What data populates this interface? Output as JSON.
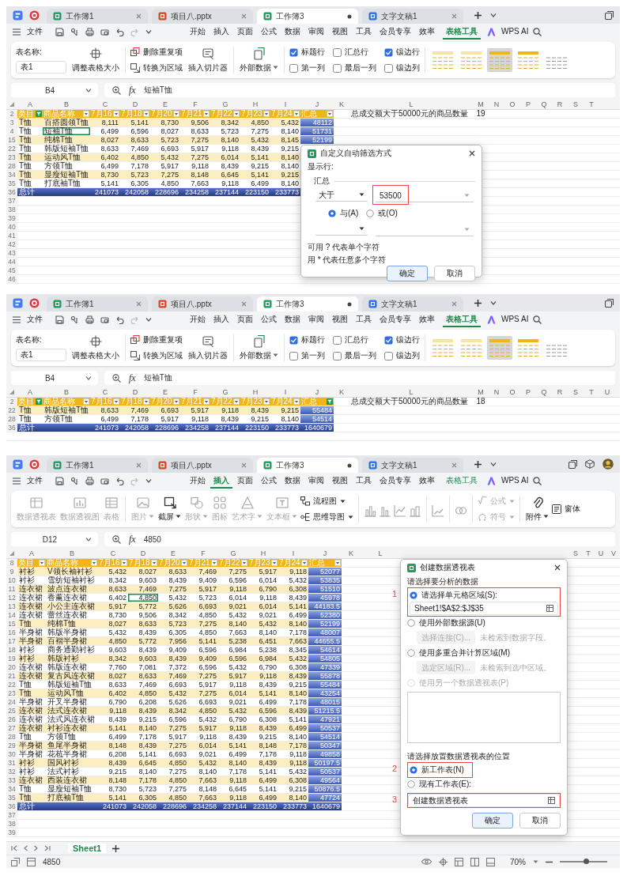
{
  "screenshots": [
    {
      "tabs": [
        {
          "label": "工作簿1",
          "kind": "sheet",
          "selected": false
        },
        {
          "label": "项目八.pptx",
          "kind": "slides",
          "selected": false
        },
        {
          "label": "工作簿3",
          "kind": "sheet",
          "selected": true
        },
        {
          "label": "文字文稿1",
          "kind": "doc",
          "selected": false
        }
      ],
      "menu": {
        "file": "文件",
        "items": [
          {
            "label": "开始",
            "selected": false
          },
          {
            "label": "插入",
            "selected": false
          },
          {
            "label": "页面",
            "selected": false
          },
          {
            "label": "公式",
            "selected": false
          },
          {
            "label": "数据",
            "selected": false
          },
          {
            "label": "审阅",
            "selected": false
          },
          {
            "label": "视图",
            "selected": false
          },
          {
            "label": "工具",
            "selected": false
          },
          {
            "label": "会员专享",
            "selected": false
          },
          {
            "label": "效率",
            "selected": false
          }
        ],
        "context": {
          "label": "表格工具",
          "selected": true
        },
        "ai": "WPS AI"
      },
      "ribbon": {
        "kind": "table_tools",
        "name_label": "表名称:",
        "table_name": "表1",
        "resize": "调整表格大小",
        "remove_duplicates": "删除重复项",
        "convert": "转换为区域",
        "slicer": "插入切片器",
        "external": "外部数据",
        "options": [
          {
            "label": "标题行",
            "checked": true
          },
          {
            "label": "汇总行",
            "checked": false
          },
          {
            "label": "镶边行",
            "checked": true
          },
          {
            "label": "第一列",
            "checked": false
          },
          {
            "label": "最后一列",
            "checked": false
          },
          {
            "label": "镶边列",
            "checked": false
          }
        ],
        "styles": [
          {
            "selected": false
          },
          {
            "selected": false
          },
          {
            "selected": true
          },
          {
            "selected": false
          },
          {
            "selected": false
          }
        ]
      },
      "formula": {
        "cell": "B4",
        "fx": "fx",
        "value": "短袖T恤"
      },
      "columns": [
        "A",
        "B",
        "C",
        "D",
        "E",
        "F",
        "G",
        "H",
        "I",
        "J",
        "K",
        "L",
        "M",
        "N",
        "O",
        "P",
        "Q",
        "R",
        "S",
        "T"
      ],
      "header": {
        "row": "2",
        "cells": [
          {
            "label": "类目",
            "filtered": true
          },
          {
            "label": "商品名称",
            "filtered": false
          },
          {
            "label": "7月16",
            "filtered": false
          },
          {
            "label": "7月18",
            "filtered": false
          },
          {
            "label": "7月20",
            "filtered": false
          },
          {
            "label": "7月21",
            "filtered": false
          },
          {
            "label": "7月22",
            "filtered": false
          },
          {
            "label": "7月23",
            "filtered": false
          },
          {
            "label": "7月24",
            "filtered": false
          },
          {
            "label": "汇总",
            "filtered": false
          }
        ],
        "note": {
          "label": "总成交额大于50000元的商品数量",
          "value": "19"
        }
      },
      "rows": [
        {
          "row": "3",
          "kind": "data",
          "cells": [
            "T恤",
            "百搭圆领T恤",
            "8,111",
            "5,141",
            "8,730",
            "9,506",
            "8,342",
            "4,850",
            "5,432",
            "48112"
          ]
        },
        {
          "row": "4",
          "kind": "data",
          "cells": [
            "T恤",
            {
              "text": "短袖T恤",
              "selected": true
            },
            "6,499",
            "6,596",
            "8,027",
            "8,633",
            "5,723",
            "7,275",
            "8,140",
            "51731"
          ]
        },
        {
          "row": "15",
          "kind": "data",
          "cells": [
            "T恤",
            "纯棉T恤",
            "8,027",
            "8,633",
            "5,723",
            "7,275",
            "8,140",
            "5,432",
            "8,145",
            "52199"
          ]
        },
        {
          "row": "22",
          "kind": "data",
          "cells": [
            "T恤",
            "韩版短袖T恤",
            "8,633",
            "7,469",
            "6,693",
            "5,917",
            "9,118",
            "8,439",
            "9,215",
            null
          ]
        },
        {
          "row": "23",
          "kind": "data",
          "cells": [
            "T恤",
            "运动风T恤",
            "6,402",
            "4,850",
            "5,432",
            "7,275",
            "6,014",
            "5,141",
            "8,140",
            null
          ]
        },
        {
          "row": "28",
          "kind": "data",
          "cells": [
            "T恤",
            "方领T恤",
            "6,499",
            "7,178",
            "5,917",
            "9,118",
            "8,439",
            "9,215",
            "8,140",
            null
          ]
        },
        {
          "row": "34",
          "kind": "data",
          "cells": [
            "T恤",
            "显瘦短袖T恤",
            "8,730",
            "5,723",
            "7,275",
            "8,148",
            "6,645",
            "5,141",
            "9,215",
            null
          ]
        },
        {
          "row": "35",
          "kind": "data",
          "cells": [
            "T恤",
            "打底袖T恤",
            "5,141",
            "6,305",
            "4,850",
            "7,663",
            "9,118",
            "6,499",
            "8,140",
            null
          ]
        },
        {
          "row": "36",
          "kind": "total",
          "cells": [
            "总计",
            null,
            "241073",
            "242058",
            "228696",
            "234258",
            "237144",
            "223150",
            "233773",
            null
          ]
        }
      ],
      "empty_rows": [
        "37",
        "38",
        "39",
        "40",
        "41",
        "42",
        "43",
        "44",
        "45",
        "46"
      ],
      "dialog": {
        "kind": "autofilter",
        "title": "自定义自动筛选方式",
        "show_rows": "显示行:",
        "field": "汇总",
        "conditions": [
          {
            "operator": "大于",
            "value": "53500",
            "marked": true
          },
          {
            "marked": false
          }
        ],
        "logic": [
          {
            "label": "与(A)",
            "selected": true
          },
          {
            "label": "或(O)",
            "selected": false
          }
        ],
        "hints": [
          "可用 ? 代表单个字符",
          "用 * 代表任意多个字符"
        ],
        "buttons": [
          {
            "label": "确定",
            "kind": "primary"
          },
          {
            "label": "取消",
            "kind": "normal"
          }
        ]
      }
    },
    {
      "tabs": [
        {
          "label": "工作簿1",
          "kind": "sheet",
          "selected": false
        },
        {
          "label": "项目八.pptx",
          "kind": "slides",
          "selected": false
        },
        {
          "label": "工作簿3",
          "kind": "sheet",
          "selected": true
        },
        {
          "label": "文字文稿1",
          "kind": "doc",
          "selected": false
        }
      ],
      "menu": {
        "file": "文件",
        "items": [
          {
            "label": "开始",
            "selected": false
          },
          {
            "label": "插入",
            "selected": false
          },
          {
            "label": "页面",
            "selected": false
          },
          {
            "label": "公式",
            "selected": false
          },
          {
            "label": "数据",
            "selected": false
          },
          {
            "label": "审阅",
            "selected": false
          },
          {
            "label": "视图",
            "selected": false
          },
          {
            "label": "工具",
            "selected": false
          },
          {
            "label": "会员专享",
            "selected": false
          },
          {
            "label": "效率",
            "selected": false
          }
        ],
        "context": {
          "label": "表格工具",
          "selected": true
        },
        "ai": "WPS AI"
      },
      "ribbon": {
        "kind": "table_tools",
        "name_label": "表名称:",
        "table_name": "表1",
        "resize": "调整表格大小",
        "remove_duplicates": "删除重复项",
        "convert": "转换为区域",
        "slicer": "插入切片器",
        "external": "外部数据",
        "options": [
          {
            "label": "标题行",
            "checked": true
          },
          {
            "label": "汇总行",
            "checked": false
          },
          {
            "label": "镶边行",
            "checked": true
          },
          {
            "label": "第一列",
            "checked": false
          },
          {
            "label": "最后一列",
            "checked": false
          },
          {
            "label": "镶边列",
            "checked": false
          }
        ],
        "styles": [
          {
            "selected": false
          },
          {
            "selected": false
          },
          {
            "selected": true
          },
          {
            "selected": false
          },
          {
            "selected": false
          }
        ]
      },
      "formula": {
        "cell": "B4",
        "fx": "fx",
        "value": "短袖T恤"
      },
      "columns": [
        "A",
        "B",
        "C",
        "D",
        "E",
        "F",
        "G",
        "H",
        "I",
        "J",
        "K",
        "L",
        "M",
        "N",
        "O",
        "P",
        "Q",
        "R",
        "S",
        "T",
        "U"
      ],
      "header": {
        "row": "2",
        "cells": [
          {
            "label": "类目",
            "filtered": true
          },
          {
            "label": "商品名称",
            "filtered": false
          },
          {
            "label": "7月16",
            "filtered": false
          },
          {
            "label": "7月18",
            "filtered": false
          },
          {
            "label": "7月20",
            "filtered": false
          },
          {
            "label": "7月21",
            "filtered": false
          },
          {
            "label": "7月22",
            "filtered": false
          },
          {
            "label": "7月23",
            "filtered": false
          },
          {
            "label": "7月24",
            "filtered": false
          },
          {
            "label": "汇总",
            "filtered": true
          }
        ],
        "note": {
          "label": "总成交额大于50000元的商品数量",
          "value": "18"
        }
      },
      "rows": [
        {
          "row": "22",
          "kind": "data",
          "cells": [
            "T恤",
            "韩版短袖T恤",
            "8,633",
            "7,469",
            "6,693",
            "5,917",
            "9,118",
            "8,439",
            "9,215",
            "55484"
          ]
        },
        {
          "row": "28",
          "kind": "data",
          "cells": [
            "T恤",
            "方领T恤",
            "6,499",
            "7,178",
            "5,917",
            "9,118",
            "8,439",
            "9,215",
            "8,140",
            "54514"
          ]
        },
        {
          "row": "36",
          "kind": "total",
          "cells": [
            "总计",
            null,
            "241073",
            "242058",
            "228696",
            "234258",
            "237144",
            "223150",
            "233773",
            "1640679"
          ]
        }
      ]
    },
    {
      "tabs": [
        {
          "label": "工作簿1",
          "kind": "sheet",
          "selected": false
        },
        {
          "label": "项目八.pptx",
          "kind": "slides",
          "selected": false
        },
        {
          "label": "工作簿3",
          "kind": "sheet",
          "selected": true
        },
        {
          "label": "文字文稿1",
          "kind": "doc",
          "selected": false
        }
      ],
      "account": true,
      "menu": {
        "file": "文件",
        "items": [
          {
            "label": "开始",
            "selected": false
          },
          {
            "label": "插入",
            "selected": true
          },
          {
            "label": "页面",
            "selected": false
          },
          {
            "label": "公式",
            "selected": false
          },
          {
            "label": "数据",
            "selected": false
          },
          {
            "label": "审阅",
            "selected": false
          },
          {
            "label": "视图",
            "selected": false
          },
          {
            "label": "工具",
            "selected": false
          },
          {
            "label": "会员专享",
            "selected": false
          },
          {
            "label": "效率",
            "selected": false
          }
        ],
        "context": {
          "label": "表格工具",
          "selected": false
        },
        "ai": "WPS AI"
      },
      "ribbon": {
        "kind": "insert",
        "groups": [
          {
            "items": [
              {
                "kind": "big",
                "label": "数据透视表",
                "disabled": true
              },
              {
                "kind": "big",
                "label": "数据透视图",
                "disabled": true
              },
              {
                "kind": "big",
                "label": "表格",
                "disabled": true
              }
            ]
          },
          {
            "items": [
              {
                "kind": "big",
                "label": "图片",
                "caret": true,
                "disabled": true
              },
              {
                "kind": "big",
                "label": "截屏",
                "caret": true,
                "disabled": false
              },
              {
                "kind": "big",
                "label": "形状",
                "caret": true,
                "disabled": true
              },
              {
                "kind": "big",
                "label": "图标",
                "disabled": true
              },
              {
                "kind": "big",
                "label": "艺术字",
                "caret": true,
                "disabled": true
              },
              {
                "kind": "big",
                "label": "文本框",
                "caret": true,
                "disabled": true
              },
              {
                "kind": "small",
                "label": "流程图",
                "caret": true,
                "disabled": false
              },
              {
                "kind": "small",
                "label": "思维导图",
                "caret": true,
                "disabled": false
              }
            ]
          },
          {
            "items": [
              {
                "kind": "chart",
                "disabled": true
              },
              {
                "kind": "chart",
                "disabled": true
              },
              {
                "kind": "chart",
                "disabled": true
              },
              {
                "kind": "chart",
                "disabled": true
              }
            ]
          },
          {
            "items": [
              {
                "kind": "chart",
                "disabled": true
              }
            ]
          },
          {
            "items": [
              {
                "kind": "chart",
                "disabled": true
              }
            ]
          },
          {
            "items": [
              {
                "kind": "small",
                "label": "公式",
                "caret": true,
                "disabled": true
              },
              {
                "kind": "small",
                "label": "符号",
                "caret": true,
                "disabled": true
              }
            ]
          },
          {
            "items": [
              {
                "kind": "big",
                "label": "附件",
                "caret": true,
                "disabled": false
              },
              {
                "kind": "small",
                "label": "窗体",
                "disabled": false
              }
            ]
          }
        ]
      },
      "formula": {
        "cell": "D12",
        "fx": "fx",
        "value": "4850"
      },
      "columns": [
        "A",
        "B",
        "C",
        "D",
        "E",
        "F",
        "G",
        "H",
        "I",
        "J",
        "K",
        "L"
      ],
      "columns_right": [
        "S",
        "T",
        "U",
        "V"
      ],
      "header": {
        "row": "8",
        "cells": [
          {
            "label": "类目",
            "filtered": false
          },
          {
            "label": "商品名称",
            "filtered": false
          },
          {
            "label": "7月16",
            "filtered": false
          },
          {
            "label": "7月18",
            "filtered": false
          },
          {
            "label": "7月20",
            "filtered": false
          },
          {
            "label": "7月21",
            "filtered": false
          },
          {
            "label": "7月22",
            "filtered": false
          },
          {
            "label": "7月23",
            "filtered": false
          },
          {
            "label": "7月24",
            "filtered": false
          },
          {
            "label": "汇总",
            "filtered": false
          }
        ]
      },
      "rows": [
        {
          "row": "9",
          "kind": "data",
          "cells": [
            "衬衫",
            "V领长袖衬衫",
            "5,432",
            "8,027",
            "8,633",
            "7,469",
            "7,275",
            "5,917",
            "9,118",
            "52077"
          ]
        },
        {
          "row": "10",
          "kind": "data",
          "cells": [
            "衬衫",
            "雪纺短袖衬衫",
            "8,342",
            "9,603",
            "8,439",
            "9,409",
            "6,596",
            "6,014",
            "5,432",
            "53835"
          ]
        },
        {
          "row": "11",
          "kind": "data",
          "cells": [
            "连衣裙",
            "波点连衣裙",
            "8,633",
            "7,469",
            "7,275",
            "5,917",
            "9,118",
            "6,790",
            "6,308",
            "51510"
          ]
        },
        {
          "row": "12",
          "kind": "data",
          "cells": [
            "连衣裙",
            "香薰连衣裙",
            "6,402",
            {
              "text": "4,850",
              "selected": true
            },
            "5,432",
            "5,723",
            "6,014",
            "9,118",
            "8,439",
            "45978"
          ]
        },
        {
          "row": "13",
          "kind": "data",
          "cells": [
            "连衣裙",
            "小公主连衣裙",
            "5,917",
            "5,772",
            "5,626",
            "6,693",
            "9,021",
            "6,014",
            "5,141",
            "44183.5"
          ]
        },
        {
          "row": "14",
          "kind": "data",
          "cells": [
            "连衣裙",
            "蕾丝连衣裙",
            "8,730",
            "9,506",
            "8,342",
            "4,850",
            "5,432",
            "9,021",
            "6,499",
            "52380"
          ]
        },
        {
          "row": "15",
          "kind": "data",
          "cells": [
            "T恤",
            "纯棉T恤",
            "8,027",
            "8,633",
            "5,723",
            "7,275",
            "8,140",
            "5,432",
            "8,140",
            "52199"
          ]
        },
        {
          "row": "16",
          "kind": "data",
          "cells": [
            "半身裙",
            "韩版半身裙",
            "5,432",
            "8,439",
            "6,305",
            "4,850",
            "7,663",
            "8,140",
            "7,178",
            "48007"
          ]
        },
        {
          "row": "17",
          "kind": "data",
          "cells": [
            "半身裙",
            "百褶半身裙",
            "4,850",
            "5,772",
            "7,956",
            "5,141",
            "5,238",
            "6,451",
            "7,663",
            "44655.5"
          ]
        },
        {
          "row": "18",
          "kind": "data",
          "cells": [
            "衬衫",
            "商务通勤衬衫",
            "9,603",
            "8,439",
            "9,409",
            "6,596",
            "6,984",
            "5,238",
            "8,345",
            "54614"
          ]
        },
        {
          "row": "19",
          "kind": "data",
          "cells": [
            "衬衫",
            "韩版衬衫",
            "8,342",
            "9,603",
            "8,439",
            "9,409",
            "6,596",
            "6,984",
            "5,432",
            "54805"
          ]
        },
        {
          "row": "20",
          "kind": "data",
          "cells": [
            "连衣裙",
            "韩版连衣裙",
            "7,760",
            "7,081",
            "7,372",
            "6,596",
            "5,432",
            "6,790",
            "6,308",
            "47339"
          ]
        },
        {
          "row": "21",
          "kind": "data",
          "cells": [
            "连衣裙",
            "复古风连衣裙",
            "8,027",
            "8,633",
            "7,469",
            "7,275",
            "5,917",
            "9,118",
            "8,439",
            "55878"
          ]
        },
        {
          "row": "22",
          "kind": "data",
          "cells": [
            "T恤",
            "韩版短袖T恤",
            "8,633",
            "7,469",
            "6,693",
            "5,917",
            "9,118",
            "8,439",
            "9,215",
            "55484"
          ]
        },
        {
          "row": "23",
          "kind": "data",
          "cells": [
            "T恤",
            "运动风T恤",
            "6,402",
            "4,850",
            "5,432",
            "7,275",
            "6,014",
            "5,141",
            "8,140",
            "43254"
          ]
        },
        {
          "row": "24",
          "kind": "data",
          "cells": [
            "半身裙",
            "开叉半身裙",
            "6,790",
            "6,208",
            "5,626",
            "6,693",
            "9,021",
            "6,499",
            "7,178",
            "48015"
          ]
        },
        {
          "row": "25",
          "kind": "data",
          "cells": [
            "连衣裙",
            "法式连衣裙",
            "9,118",
            "8,439",
            "8,342",
            "4,850",
            "5,432",
            "6,596",
            "8,439",
            "51215.5"
          ]
        },
        {
          "row": "26",
          "kind": "data",
          "cells": [
            "连衣裙",
            "法式风连衣裙",
            "8,439",
            "9,215",
            "6,596",
            "5,432",
            "6,790",
            "6,308",
            "5,141",
            "47921"
          ]
        },
        {
          "row": "27",
          "kind": "data",
          "cells": [
            "连衣裙",
            "衬衫连衣裙",
            "5,141",
            "8,140",
            "7,275",
            "5,917",
            "9,118",
            "8,439",
            "6,499",
            "50537"
          ]
        },
        {
          "row": "28",
          "kind": "data",
          "cells": [
            "T恤",
            "方领T恤",
            "6,499",
            "7,178",
            "5,917",
            "9,118",
            "8,439",
            "9,215",
            "8,140",
            "54514"
          ]
        },
        {
          "row": "29",
          "kind": "data",
          "cells": [
            "半身裙",
            "鱼尾半身裙",
            "8,148",
            "8,439",
            "7,275",
            "6,014",
            "5,141",
            "8,148",
            "7,178",
            "50347"
          ]
        },
        {
          "row": "30",
          "kind": "data",
          "cells": [
            "半身裙",
            "花苞半身裙",
            "6,208",
            "5,141",
            "6,693",
            "9,021",
            "6,499",
            "7,178",
            "9,118",
            "49858"
          ]
        },
        {
          "row": "31",
          "kind": "data",
          "cells": [
            "衬衫",
            "国风衬衫",
            "8,439",
            "6,645",
            "4,850",
            "5,432",
            "8,140",
            "8,439",
            "9,118",
            "50197.5"
          ]
        },
        {
          "row": "32",
          "kind": "data",
          "cells": [
            "衬衫",
            "法式衬衫",
            "9,215",
            "8,140",
            "7,275",
            "8,140",
            "7,178",
            "5,141",
            "5,432",
            "50537"
          ]
        },
        {
          "row": "33",
          "kind": "data",
          "cells": [
            "连衣裙",
            "西装连衣裙",
            "8,148",
            "7,178",
            "4,850",
            "7,663",
            "9,118",
            "6,499",
            "6,308",
            "49564"
          ]
        },
        {
          "row": "34",
          "kind": "data",
          "cells": [
            "T恤",
            "显瘦短袖T恤",
            "8,730",
            "5,723",
            "7,275",
            "8,148",
            "6,645",
            "5,141",
            "9,215",
            "50876.5"
          ]
        },
        {
          "row": "35",
          "kind": "data",
          "cells": [
            "T恤",
            "打底袖T恤",
            "5,141",
            "6,305",
            "4,850",
            "7,663",
            "9,118",
            "6,499",
            "8,140",
            "47724"
          ]
        },
        {
          "row": "36",
          "kind": "total",
          "cells": [
            "总计",
            null,
            "241073",
            "242058",
            "228696",
            "234258",
            "237144",
            "223150",
            "233773",
            "1640679"
          ]
        }
      ],
      "empty_rows": [
        "37",
        "38",
        "39"
      ],
      "dialog": {
        "kind": "pivot",
        "title": "创建数据透视表",
        "section": "请选择要分析的数据",
        "options": [
          {
            "kind": "range",
            "label": "请选择单元格区域(S):",
            "selected": true,
            "value": "Sheet1!$A$2:$J$35",
            "marker": "1"
          },
          {
            "kind": "connection",
            "label": "使用外部数据源(U)",
            "selected": false,
            "button": "选择连接(C)...",
            "hint": "未检索到数据字段。"
          },
          {
            "kind": "connection",
            "label": "使用多重合并计算区域(M)",
            "selected": false,
            "button": "选定区域(R)...",
            "hint": "未检索到选中区域。"
          },
          {
            "kind": "list",
            "label": "使用另一个数据透视表(P)",
            "selected": false
          }
        ],
        "place_section": "请选择放置数据透视表的位置",
        "place_options": [
          {
            "label": "新工作表(N)",
            "selected": true,
            "marker": "2"
          },
          {
            "label": "现有工作表(E):",
            "selected": false
          }
        ],
        "place_value": {
          "value": "创建数据透视表",
          "marker": "3"
        },
        "buttons": [
          {
            "label": "确定",
            "kind": "primary"
          },
          {
            "label": "取消",
            "kind": "normal"
          }
        ]
      },
      "sheet_tabs": [
        {
          "label": "Sheet1",
          "selected": true
        }
      ],
      "status": {
        "value": "4850",
        "zoom": "70%",
        "zoom_slider": {
          "level": 0.55
        }
      }
    }
  ]
}
